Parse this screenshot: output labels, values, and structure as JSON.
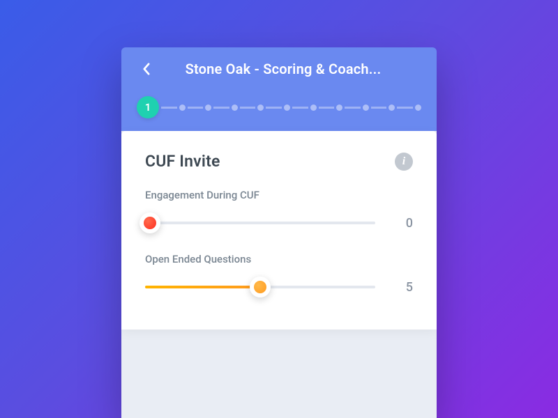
{
  "header": {
    "title": "Stone Oak - Scoring & Coach..."
  },
  "stepper": {
    "current": "1",
    "totalSteps": 11
  },
  "card": {
    "title": "CUF Invite",
    "fields": [
      {
        "label": "Engagement During CUF",
        "value": "0",
        "percent": 2,
        "color": "red"
      },
      {
        "label": "Open Ended Questions",
        "value": "5",
        "percent": 50,
        "color": "orange"
      }
    ]
  }
}
